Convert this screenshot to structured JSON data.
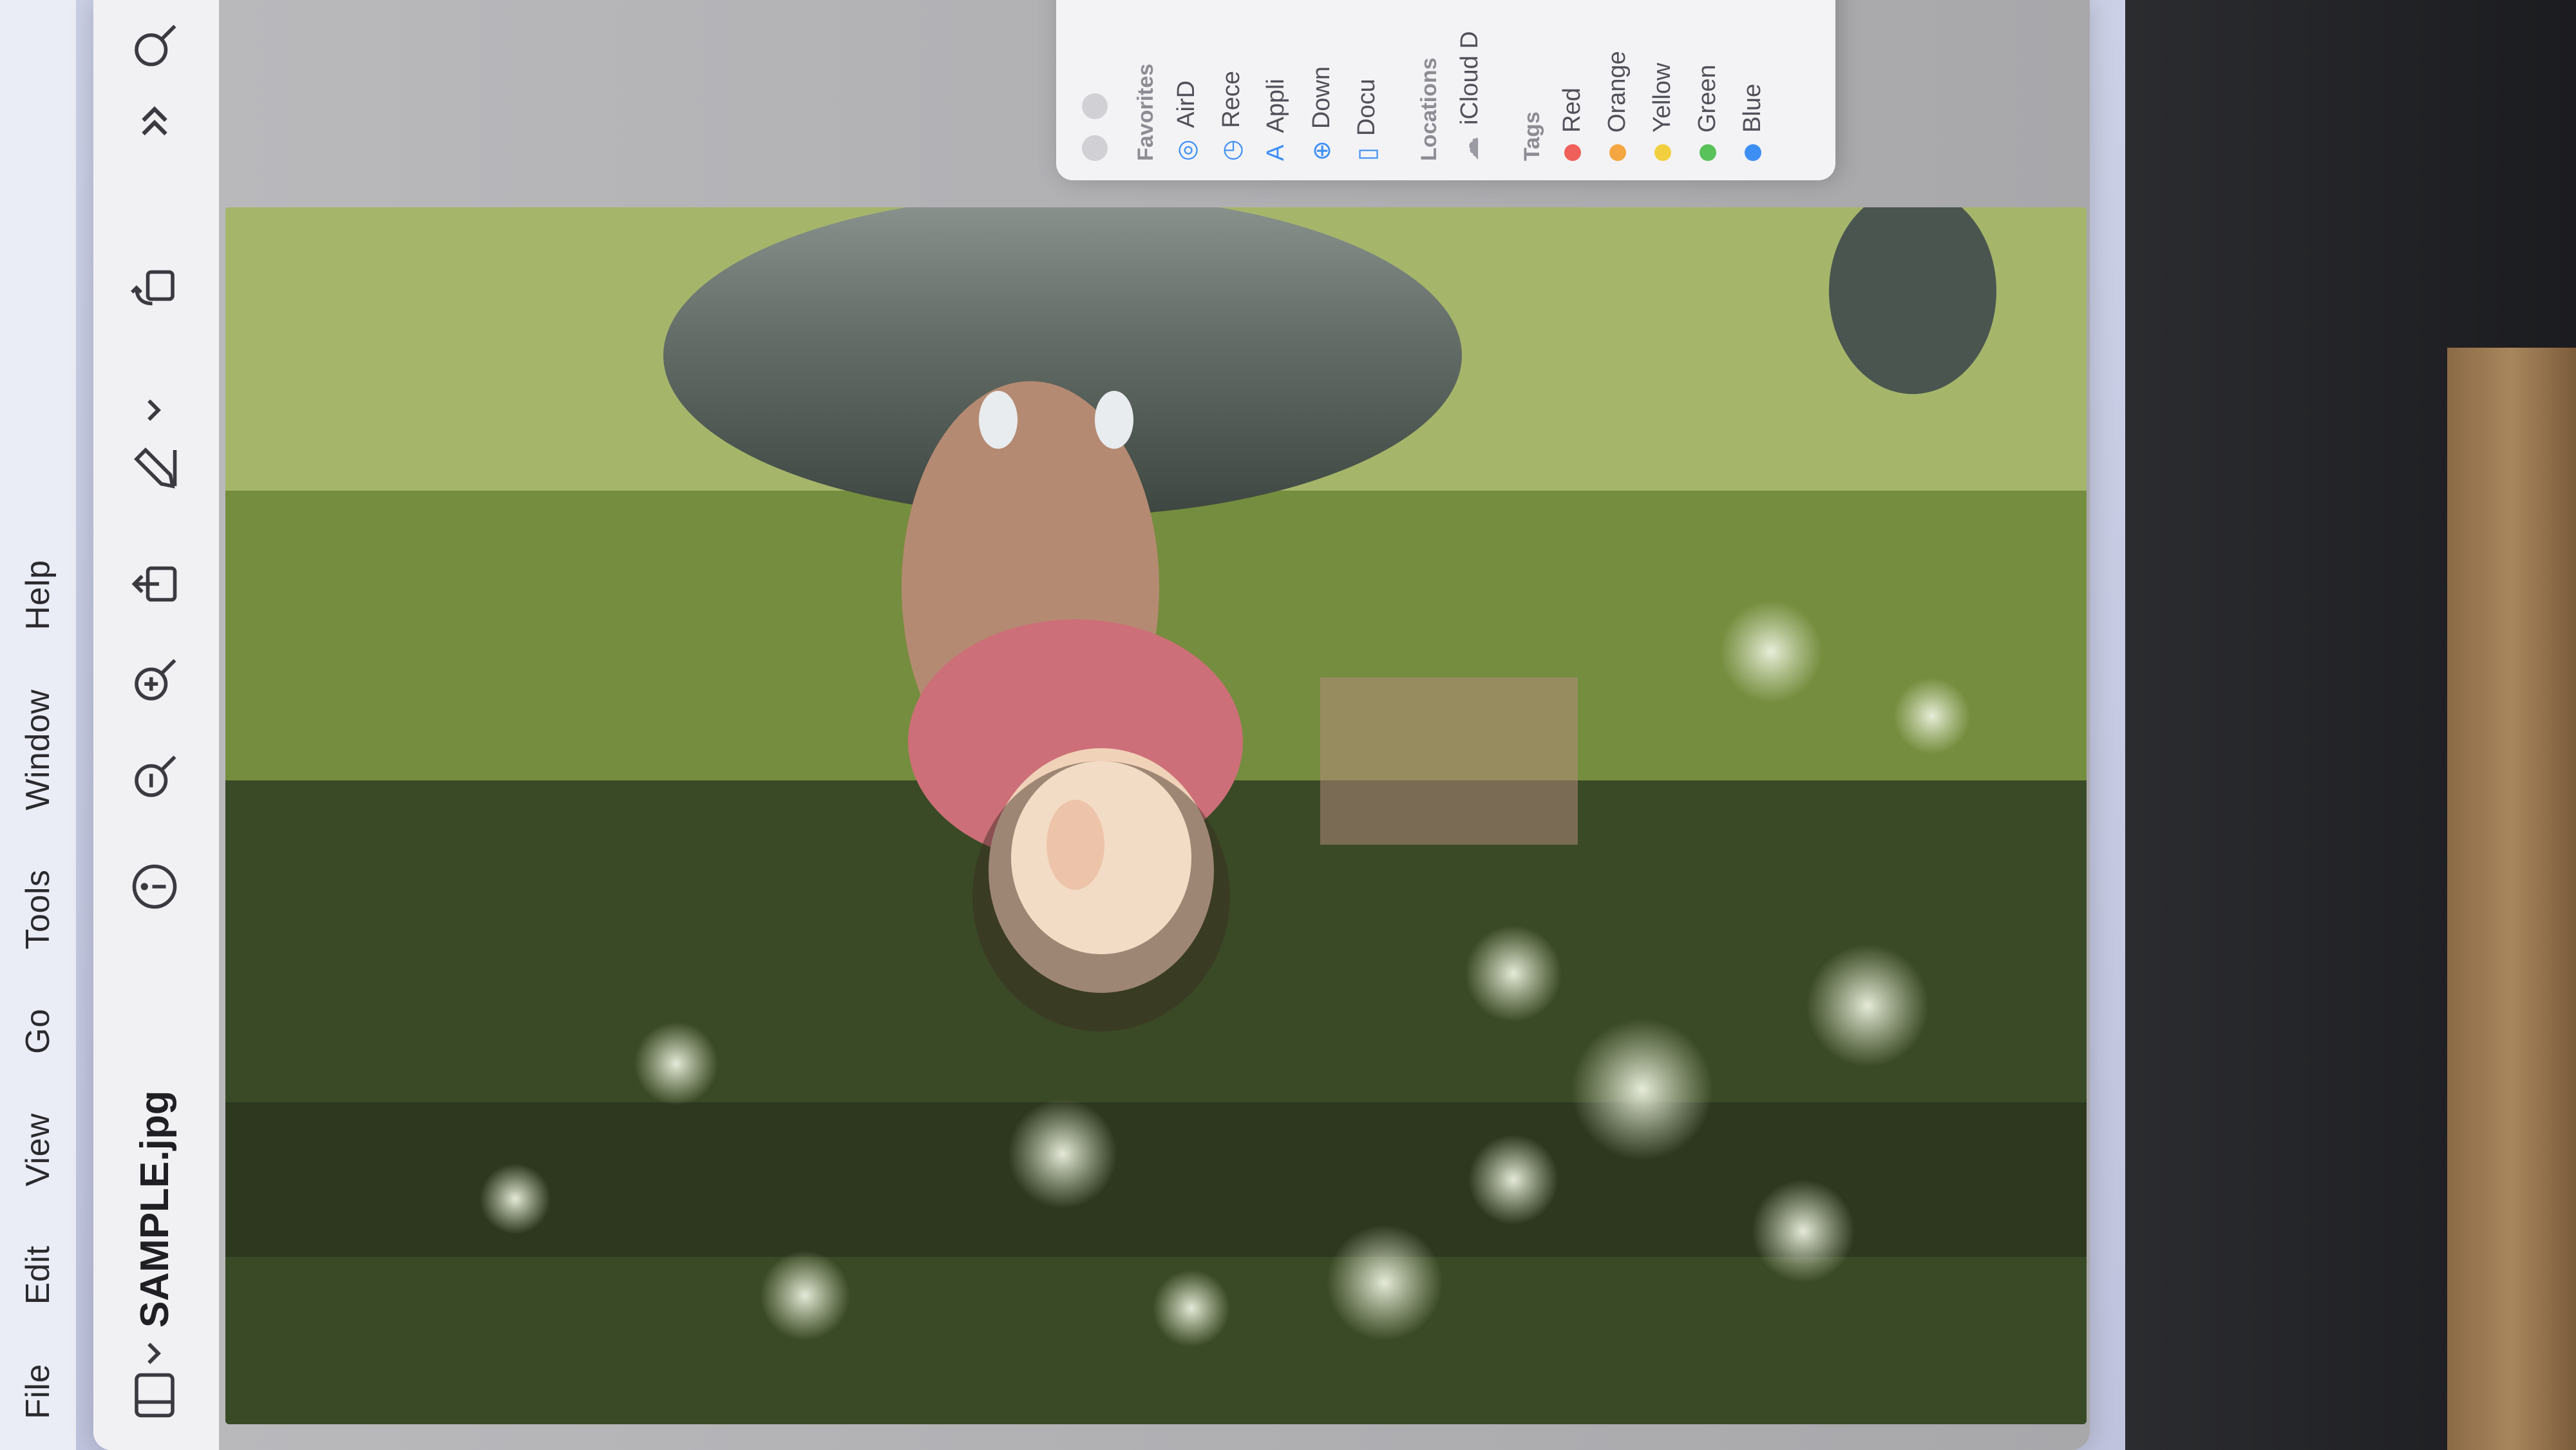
{
  "menubar": {
    "items": [
      "File",
      "Edit",
      "View",
      "Go",
      "Tools",
      "Window",
      "Help"
    ]
  },
  "window": {
    "title": "SAMPLE.jpg"
  },
  "toolbar": {
    "icons": [
      "sidebar-icon",
      "chevron-down-icon",
      "info-icon",
      "zoom-out-icon",
      "zoom-in-icon",
      "share-icon",
      "markup-pencil-icon",
      "chevron-down-icon",
      "rotate-icon",
      "more-chevrons-icon",
      "search-icon"
    ]
  },
  "finder": {
    "favorites_header": "Favorites",
    "favorites": [
      "AirD",
      "Rece",
      "Appli",
      "Down",
      "Docu"
    ],
    "locations_header": "Locations",
    "locations": [
      "iCloud D"
    ],
    "tags_header": "Tags",
    "tags": [
      {
        "name": "Red",
        "color": "#f0605a"
      },
      {
        "name": "Orange",
        "color": "#f4a640"
      },
      {
        "name": "Yellow",
        "color": "#f2cf3f"
      },
      {
        "name": "Green",
        "color": "#5ac25a"
      },
      {
        "name": "Blue",
        "color": "#3d8ff5"
      }
    ]
  },
  "colors": {
    "accent": "#3d8ff5",
    "menubar_bg": "#eceef7",
    "window_bg": "#f4f4f6"
  }
}
